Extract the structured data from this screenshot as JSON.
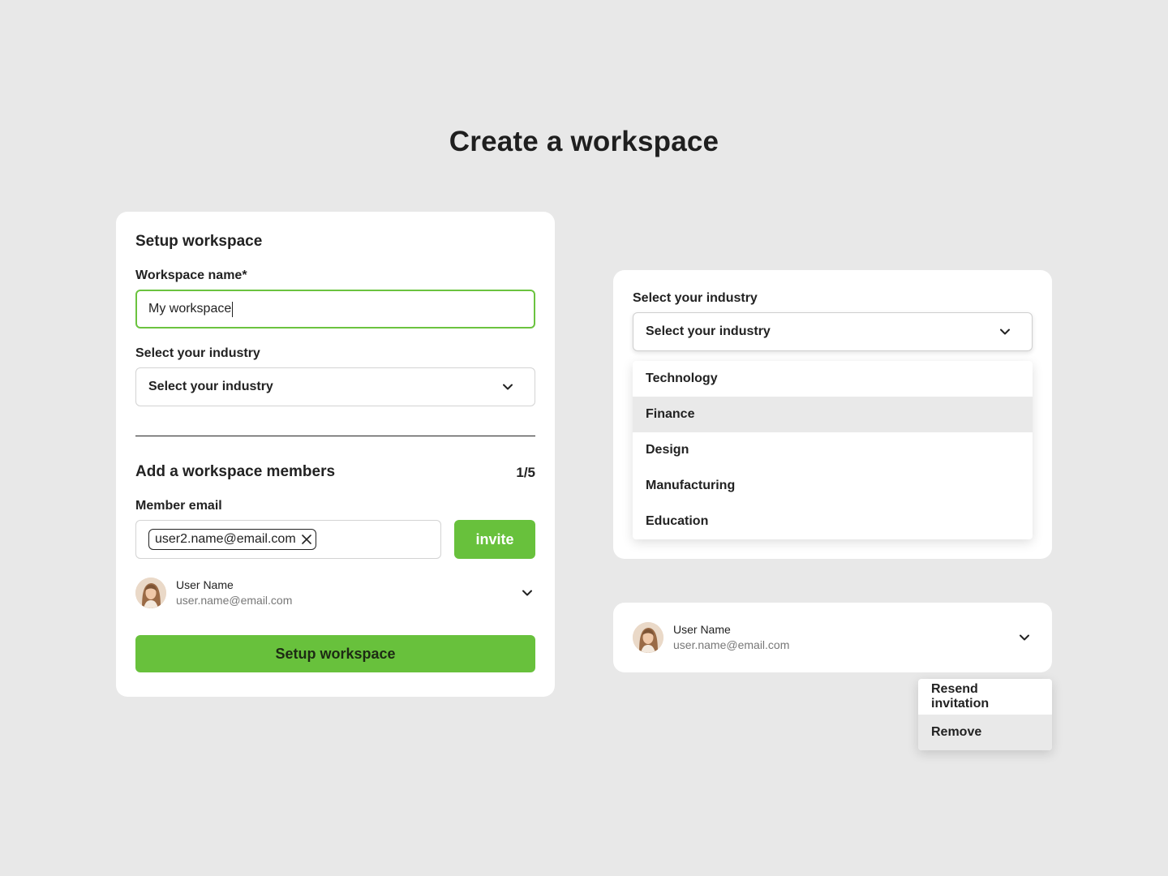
{
  "page": {
    "title": "Create a workspace"
  },
  "setup": {
    "heading": "Setup workspace",
    "workspace_name_label": "Workspace name*",
    "workspace_name_value": "My workspace",
    "industry_label": "Select your industry",
    "industry_value": "Select your industry",
    "members_heading": "Add a workspace members",
    "members_count": "1/5",
    "member_email_label": "Member email",
    "email_chip": "user2.name@email.com",
    "invite_label": "invite",
    "user": {
      "name": "User Name",
      "email": "user.name@email.com"
    },
    "submit_label": "Setup workspace"
  },
  "industry_panel": {
    "label": "Select your industry",
    "select_value": "Select your industry",
    "options": [
      "Technology",
      "Finance",
      "Design",
      "Manufacturing",
      "Education"
    ],
    "highlighted_option": "Finance"
  },
  "member_panel": {
    "user": {
      "name": "User Name",
      "email": "user.name@email.com"
    },
    "menu": [
      "Resend invitation",
      "Remove"
    ],
    "highlighted_menu_item": "Remove"
  },
  "colors": {
    "background": "#e8e8e8",
    "accent_green": "#68c13c",
    "focus_border": "#6bc33f",
    "highlight": "#e9e9e9"
  },
  "icons": {
    "chevron": "chevron-down-icon",
    "remove_chip": "close-icon",
    "avatar": "user-avatar"
  }
}
